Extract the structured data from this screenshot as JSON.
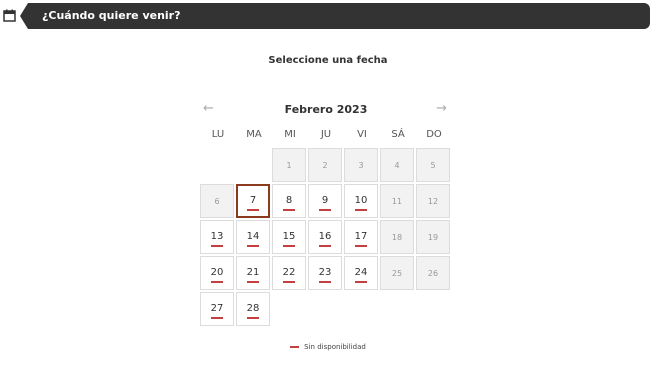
{
  "header": {
    "title": "¿Cuándo quiere venir?",
    "icon": "calendar-icon"
  },
  "subtitle": "Seleccione una fecha",
  "calendar": {
    "month_label": "Febrero 2023",
    "prev_icon": "←",
    "next_icon": "→",
    "weekdays": [
      "LU",
      "MA",
      "MI",
      "JU",
      "VI",
      "SÁ",
      "DO"
    ],
    "leading_blank_days": 2,
    "days": [
      {
        "n": "1",
        "available": false
      },
      {
        "n": "2",
        "available": false
      },
      {
        "n": "3",
        "available": false
      },
      {
        "n": "4",
        "available": false
      },
      {
        "n": "5",
        "available": false
      },
      {
        "n": "6",
        "available": false
      },
      {
        "n": "7",
        "available": true,
        "selected": true
      },
      {
        "n": "8",
        "available": true
      },
      {
        "n": "9",
        "available": true
      },
      {
        "n": "10",
        "available": true
      },
      {
        "n": "11",
        "available": false
      },
      {
        "n": "12",
        "available": false
      },
      {
        "n": "13",
        "available": true
      },
      {
        "n": "14",
        "available": true
      },
      {
        "n": "15",
        "available": true
      },
      {
        "n": "16",
        "available": true
      },
      {
        "n": "17",
        "available": true
      },
      {
        "n": "18",
        "available": false
      },
      {
        "n": "19",
        "available": false
      },
      {
        "n": "20",
        "available": true
      },
      {
        "n": "21",
        "available": true
      },
      {
        "n": "22",
        "available": true
      },
      {
        "n": "23",
        "available": true
      },
      {
        "n": "24",
        "available": true
      },
      {
        "n": "25",
        "available": false
      },
      {
        "n": "26",
        "available": false
      },
      {
        "n": "27",
        "available": true
      },
      {
        "n": "28",
        "available": true
      }
    ]
  },
  "legend": {
    "label": "Sin disponibilidad"
  },
  "colors": {
    "header_bg": "#333333",
    "accent_underline": "#c44040",
    "selected_border": "#8b3a1e",
    "unavailable_bg": "#f2f2f2"
  }
}
